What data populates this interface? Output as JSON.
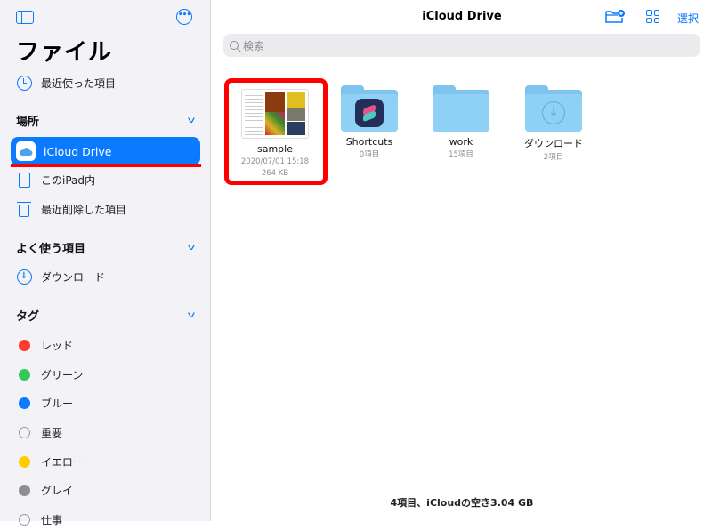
{
  "sidebar": {
    "title": "ファイル",
    "recents": "最近使った項目",
    "locations_header": "場所",
    "locations": [
      {
        "label": "iCloud Drive",
        "selected": true
      },
      {
        "label": "このiPad内"
      },
      {
        "label": "最近削除した項目"
      }
    ],
    "favorites_header": "よく使う項目",
    "favorites": [
      {
        "label": "ダウンロード"
      }
    ],
    "tags_header": "タグ",
    "tags": [
      {
        "label": "レッド",
        "color": "#ff3b30"
      },
      {
        "label": "グリーン",
        "color": "#34c759"
      },
      {
        "label": "ブルー",
        "color": "#0a7aff"
      },
      {
        "label": "重要",
        "color": ""
      },
      {
        "label": "イエロー",
        "color": "#ffcc00"
      },
      {
        "label": "グレイ",
        "color": "#8e8e93"
      },
      {
        "label": "仕事",
        "color": ""
      }
    ]
  },
  "main": {
    "title": "iCloud Drive",
    "select_label": "選択",
    "search_placeholder": "検索",
    "items": [
      {
        "name": "sample",
        "date": "2020/07/01 15:18",
        "size": "264 KB"
      },
      {
        "name": "Shortcuts",
        "count": "0項目"
      },
      {
        "name": "work",
        "count": "15項目"
      },
      {
        "name": "ダウンロード",
        "count": "2項目"
      }
    ],
    "footer": "4項目、iCloudの空き3.04 GB"
  },
  "colors": {
    "accent": "#0a7aff",
    "highlight": "#ff0000"
  }
}
